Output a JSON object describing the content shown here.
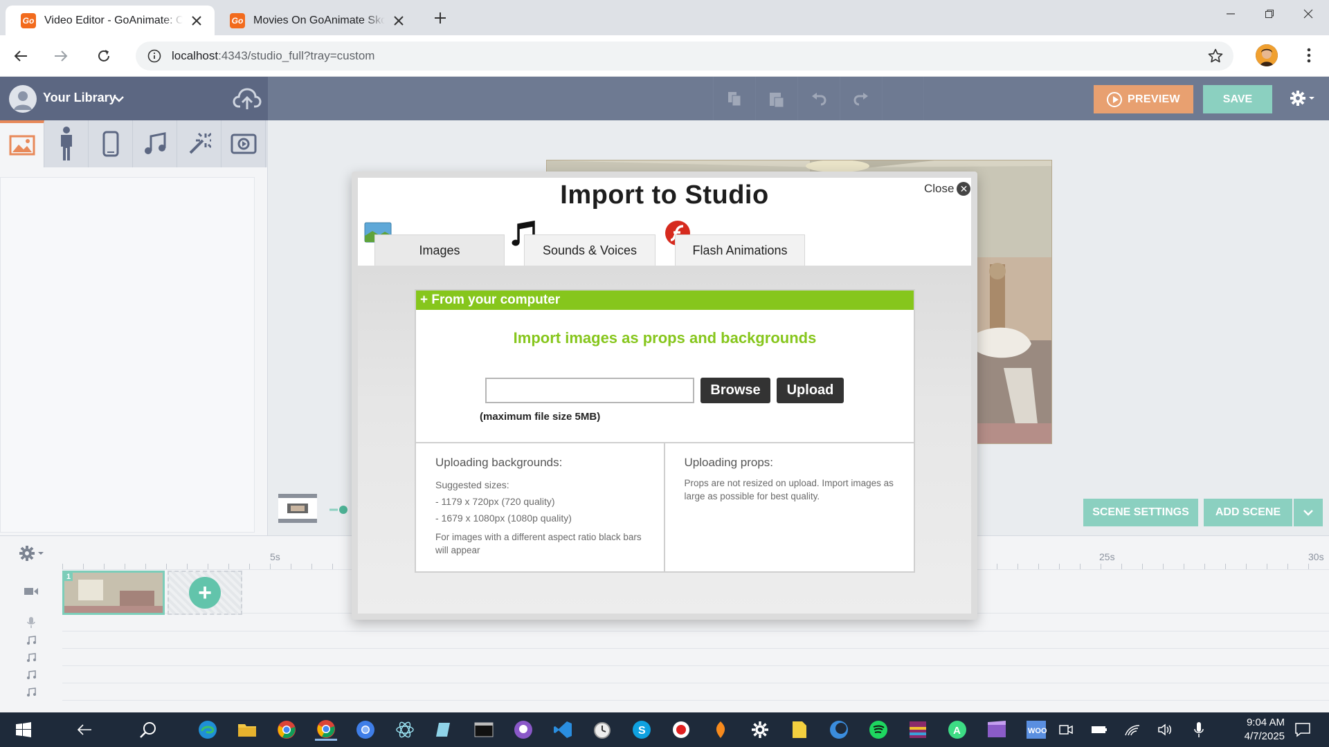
{
  "browser": {
    "tabs": [
      {
        "title": "Video Editor - GoAnimate: Online",
        "favicon": "go-logo-icon",
        "active": true
      },
      {
        "title": "Movies On GoAnimate SkoleTube",
        "favicon": "go-logo-icon",
        "active": false
      }
    ],
    "favicon_text": "Go",
    "url_host": "localhost",
    "url_rest": ":4343/studio_full?tray=custom"
  },
  "app": {
    "library_title": "Your Library",
    "preview_label": "PREVIEW",
    "save_label": "SAVE",
    "scene_settings_label": "SCENE SETTINGS",
    "add_scene_label": "ADD SCENE",
    "categories": [
      "image-icon",
      "character-icon",
      "prop-device-icon",
      "music-note-icon",
      "effects-icon",
      "video-frame-icon"
    ],
    "timeline_labels": {
      "t5": "5s",
      "t25": "25s",
      "t30": "30s"
    },
    "scene_number": "1"
  },
  "modal": {
    "title": "Import to Studio",
    "close_label": "Close",
    "tabs": [
      "Images",
      "Sounds & Voices",
      "Flash Animations"
    ],
    "section_header": "+ From your computer",
    "heading": "Import images as props and backgrounds",
    "browse_label": "Browse",
    "upload_label": "Upload",
    "max_size": "(maximum file size 5MB)",
    "backgrounds": {
      "title": "Uploading backgrounds:",
      "suggested": "Suggested sizes:",
      "size1": "- 1179 x 720px (720 quality)",
      "size2": "- 1679 x 1080px (1080p quality)",
      "note": "For images with a different aspect ratio black bars will appear"
    },
    "props": {
      "title": "Uploading props:",
      "note": "Props are not resized on upload. Import images as large as possible for best quality."
    }
  },
  "taskbar": {
    "time": "9:04 AM",
    "date": "4/7/2025"
  },
  "colors": {
    "accent_green": "#86c61c",
    "teal": "#8bd0c0",
    "preview_orange": "#e8a070",
    "header": "#6e7a92"
  }
}
